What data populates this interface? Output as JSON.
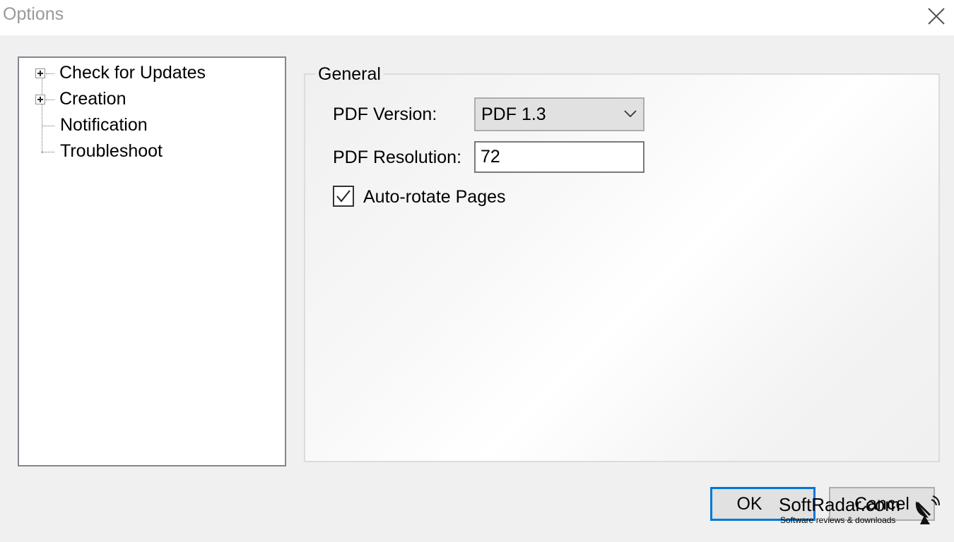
{
  "window": {
    "title": "Options"
  },
  "tree": {
    "items": [
      {
        "label": "Check for Updates",
        "expandable": true
      },
      {
        "label": "Creation",
        "expandable": true
      },
      {
        "label": "Notification",
        "expandable": false
      },
      {
        "label": "Troubleshoot",
        "expandable": false
      }
    ]
  },
  "general": {
    "legend": "General",
    "pdf_version_label": "PDF Version:",
    "pdf_version_value": "PDF 1.3",
    "pdf_resolution_label": "PDF Resolution:",
    "pdf_resolution_value": "72",
    "auto_rotate_label": "Auto-rotate Pages",
    "auto_rotate_checked": true
  },
  "buttons": {
    "ok_label": "OK",
    "cancel_label": "Cancel"
  },
  "watermark": {
    "brand": "SoftRadar.com",
    "tagline": "Software reviews & downloads"
  },
  "colors": {
    "focus_border": "#0078d7",
    "dialog_bg": "#f0f0f0"
  }
}
